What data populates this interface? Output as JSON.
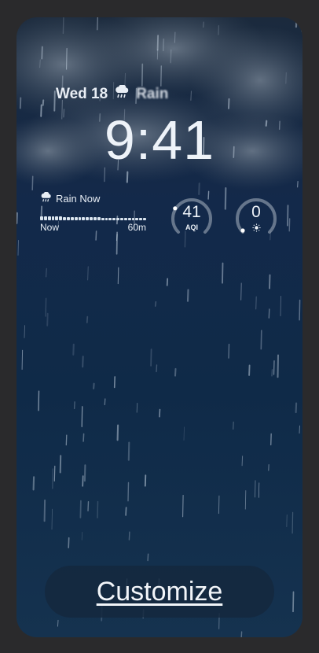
{
  "lock_screen": {
    "date": "Wed 18",
    "weather_condition": "Rain",
    "time": "9:41"
  },
  "rain_widget": {
    "title": "Rain Now",
    "start_label": "Now",
    "end_label": "60m",
    "intensity": [
      0.6,
      0.6,
      0.7,
      0.7,
      0.6,
      0.6,
      0.5,
      0.5,
      0.5,
      0.5,
      0.4,
      0.4,
      0.4,
      0.4,
      0.4,
      0.4,
      0.3,
      0.3,
      0.3,
      0.3,
      0.3,
      0.3,
      0.3,
      0.3,
      0.3,
      0.3,
      0.3,
      0.3
    ]
  },
  "aqi_widget": {
    "value": "41",
    "label": "AQI",
    "fraction": 0.27
  },
  "uv_widget": {
    "value": "0",
    "icon": "sun-icon",
    "fraction": 0.0
  },
  "customize_button": {
    "label": "Customize"
  },
  "colors": {
    "background": "#2a2a2c",
    "accent": "#eef3f9",
    "sky_top": "#1b2a3d",
    "sky_bottom": "#15324f"
  }
}
